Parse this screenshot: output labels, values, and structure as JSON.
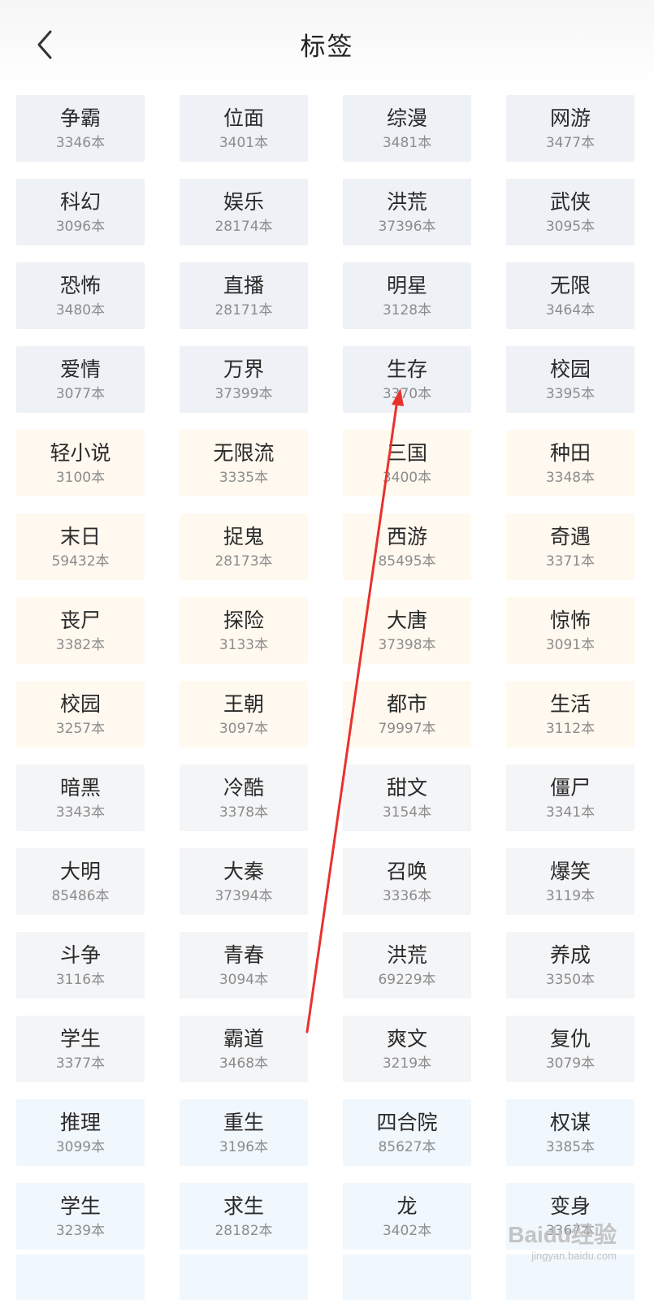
{
  "header": {
    "title": "标签"
  },
  "tags": [
    {
      "name": "争霸",
      "count": "3346本",
      "tone": "grey"
    },
    {
      "name": "位面",
      "count": "3401本",
      "tone": "grey"
    },
    {
      "name": "综漫",
      "count": "3481本",
      "tone": "grey"
    },
    {
      "name": "网游",
      "count": "3477本",
      "tone": "grey"
    },
    {
      "name": "科幻",
      "count": "3096本",
      "tone": "grey"
    },
    {
      "name": "娱乐",
      "count": "28174本",
      "tone": "grey"
    },
    {
      "name": "洪荒",
      "count": "37396本",
      "tone": "grey"
    },
    {
      "name": "武侠",
      "count": "3095本",
      "tone": "grey"
    },
    {
      "name": "恐怖",
      "count": "3480本",
      "tone": "grey"
    },
    {
      "name": "直播",
      "count": "28171本",
      "tone": "grey"
    },
    {
      "name": "明星",
      "count": "3128本",
      "tone": "grey"
    },
    {
      "name": "无限",
      "count": "3464本",
      "tone": "grey"
    },
    {
      "name": "爱情",
      "count": "3077本",
      "tone": "grey"
    },
    {
      "name": "万界",
      "count": "37399本",
      "tone": "grey"
    },
    {
      "name": "生存",
      "count": "3370本",
      "tone": "grey"
    },
    {
      "name": "校园",
      "count": "3395本",
      "tone": "grey"
    },
    {
      "name": "轻小说",
      "count": "3100本",
      "tone": "cream"
    },
    {
      "name": "无限流",
      "count": "3335本",
      "tone": "cream"
    },
    {
      "name": "三国",
      "count": "3400本",
      "tone": "cream"
    },
    {
      "name": "种田",
      "count": "3348本",
      "tone": "cream"
    },
    {
      "name": "末日",
      "count": "59432本",
      "tone": "cream"
    },
    {
      "name": "捉鬼",
      "count": "28173本",
      "tone": "cream"
    },
    {
      "name": "西游",
      "count": "85495本",
      "tone": "cream"
    },
    {
      "name": "奇遇",
      "count": "3371本",
      "tone": "cream"
    },
    {
      "name": "丧尸",
      "count": "3382本",
      "tone": "cream"
    },
    {
      "name": "探险",
      "count": "3133本",
      "tone": "cream"
    },
    {
      "name": "大唐",
      "count": "37398本",
      "tone": "cream"
    },
    {
      "name": "惊怖",
      "count": "3091本",
      "tone": "cream"
    },
    {
      "name": "校园",
      "count": "3257本",
      "tone": "cream"
    },
    {
      "name": "王朝",
      "count": "3097本",
      "tone": "cream"
    },
    {
      "name": "都市",
      "count": "79997本",
      "tone": "cream"
    },
    {
      "name": "生活",
      "count": "3112本",
      "tone": "cream"
    },
    {
      "name": "暗黑",
      "count": "3343本",
      "tone": "light"
    },
    {
      "name": "冷酷",
      "count": "3378本",
      "tone": "light"
    },
    {
      "name": "甜文",
      "count": "3154本",
      "tone": "light"
    },
    {
      "name": "僵尸",
      "count": "3341本",
      "tone": "light"
    },
    {
      "name": "大明",
      "count": "85486本",
      "tone": "light"
    },
    {
      "name": "大秦",
      "count": "37394本",
      "tone": "light"
    },
    {
      "name": "召唤",
      "count": "3336本",
      "tone": "light"
    },
    {
      "name": "爆笑",
      "count": "3119本",
      "tone": "light"
    },
    {
      "name": "斗争",
      "count": "3116本",
      "tone": "light"
    },
    {
      "name": "青春",
      "count": "3094本",
      "tone": "light"
    },
    {
      "name": "洪荒",
      "count": "69229本",
      "tone": "light"
    },
    {
      "name": "养成",
      "count": "3350本",
      "tone": "light"
    },
    {
      "name": "学生",
      "count": "3377本",
      "tone": "light"
    },
    {
      "name": "霸道",
      "count": "3468本",
      "tone": "light"
    },
    {
      "name": "爽文",
      "count": "3219本",
      "tone": "light"
    },
    {
      "name": "复仇",
      "count": "3079本",
      "tone": "light"
    },
    {
      "name": "推理",
      "count": "3099本",
      "tone": "blue"
    },
    {
      "name": "重生",
      "count": "3196本",
      "tone": "blue"
    },
    {
      "name": "四合院",
      "count": "85627本",
      "tone": "blue"
    },
    {
      "name": "权谋",
      "count": "3385本",
      "tone": "blue"
    },
    {
      "name": "学生",
      "count": "3239本",
      "tone": "blue"
    },
    {
      "name": "求生",
      "count": "28182本",
      "tone": "blue"
    },
    {
      "name": "龙",
      "count": "3402本",
      "tone": "blue"
    },
    {
      "name": "变身",
      "count": "3367本",
      "tone": "blue"
    }
  ],
  "watermark": {
    "logo": "Baidu经验",
    "site": "jingyan.baidu.com"
  },
  "annotation_color": "#e8322e"
}
